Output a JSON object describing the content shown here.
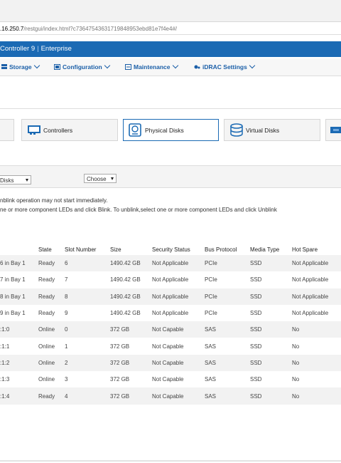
{
  "browser": {
    "url_host": ".16.250.7",
    "url_path": "/restgui/index.html?c73647543631719848953ebd81e7f4e4#/"
  },
  "brand": {
    "product": "Controller 9",
    "edition": "Enterprise"
  },
  "nav": {
    "items": [
      {
        "label": "Storage"
      },
      {
        "label": "Configuration"
      },
      {
        "label": "Maintenance"
      },
      {
        "label": "iDRAC Settings"
      }
    ]
  },
  "tabs": [
    {
      "label": ""
    },
    {
      "label": "Controllers"
    },
    {
      "label": "Physical Disks"
    },
    {
      "label": "Virtual Disks"
    },
    {
      "label": ""
    }
  ],
  "filters": {
    "view_select": "Disks",
    "action_select": "Choose"
  },
  "messages": {
    "line1": "nblink operation may not start immediately.",
    "line2": "ne or more component LEDs and click Blink. To unblink,select one or more component LEDs and click Unblink"
  },
  "table": {
    "headers": [
      "",
      "State",
      "Slot Number",
      "Size",
      "Security Status",
      "Bus Protocol",
      "Media Type",
      "Hot Spare"
    ],
    "rows": [
      [
        "6 in Bay 1",
        "Ready",
        "6",
        "1490.42 GB",
        "Not Applicable",
        "PCIe",
        "SSD",
        "Not Applicable"
      ],
      [
        "7 in Bay 1",
        "Ready",
        "7",
        "1490.42 GB",
        "Not Applicable",
        "PCIe",
        "SSD",
        "Not Applicable"
      ],
      [
        "8 in Bay 1",
        "Ready",
        "8",
        "1490.42 GB",
        "Not Applicable",
        "PCIe",
        "SSD",
        "Not Applicable"
      ],
      [
        "9 in Bay 1",
        "Ready",
        "9",
        "1490.42 GB",
        "Not Applicable",
        "PCIe",
        "SSD",
        "Not Applicable"
      ],
      [
        ":1:0",
        "Online",
        "0",
        "372 GB",
        "Not Capable",
        "SAS",
        "SSD",
        "No"
      ],
      [
        ":1:1",
        "Online",
        "1",
        "372 GB",
        "Not Capable",
        "SAS",
        "SSD",
        "No"
      ],
      [
        ":1:2",
        "Online",
        "2",
        "372 GB",
        "Not Capable",
        "SAS",
        "SSD",
        "No"
      ],
      [
        ":1:3",
        "Online",
        "3",
        "372 GB",
        "Not Capable",
        "SAS",
        "SSD",
        "No"
      ],
      [
        ":1:4",
        "Ready",
        "4",
        "372 GB",
        "Not Capable",
        "SAS",
        "SSD",
        "No"
      ]
    ]
  },
  "colors": {
    "brand_blue": "#1b6ab4",
    "nav_text": "#1b5fa8",
    "active_tab_border": "#1b6ab4"
  }
}
